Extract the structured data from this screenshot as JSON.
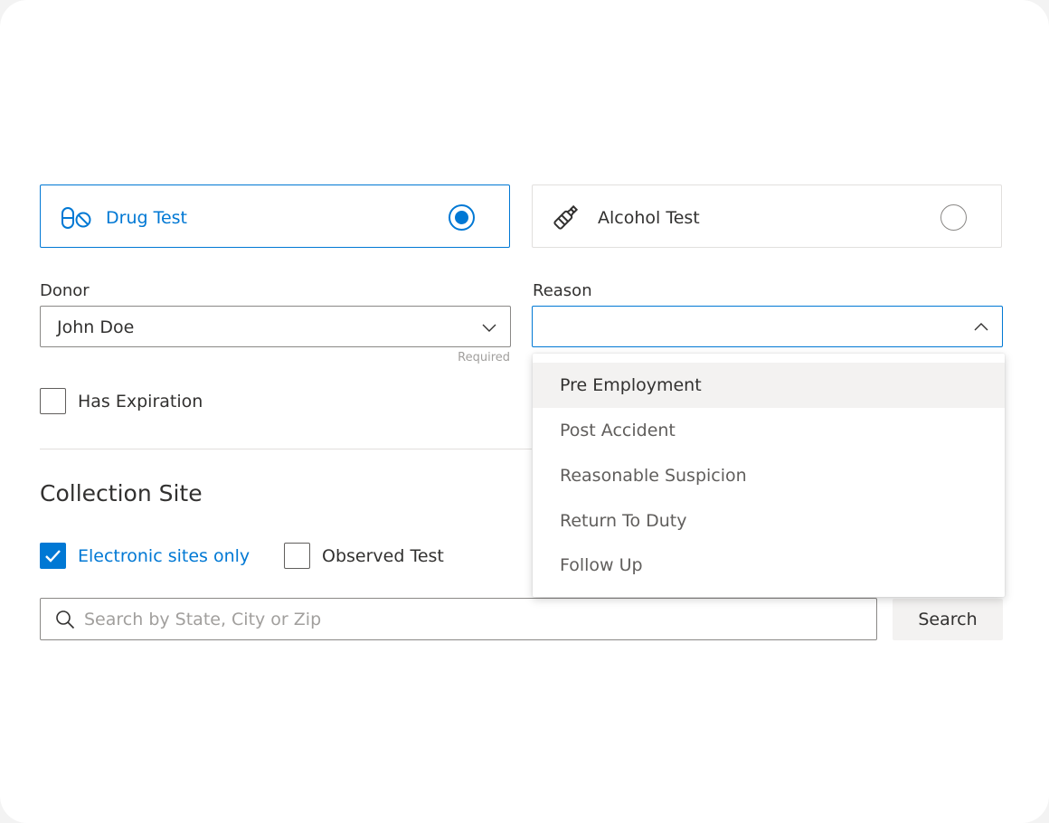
{
  "test_type": {
    "drug": {
      "label": "Drug Test",
      "selected": true,
      "icon": "pills-icon"
    },
    "alcohol": {
      "label": "Alcohol Test",
      "selected": false,
      "icon": "bottle-icon"
    }
  },
  "donor": {
    "label": "Donor",
    "value": "John Doe",
    "hint": "Required"
  },
  "reason": {
    "label": "Reason",
    "value": "",
    "options": [
      "Pre Employment",
      "Post Accident",
      "Reasonable Suspicion",
      "Return To Duty",
      "Follow Up"
    ],
    "highlighted_index": 0
  },
  "has_expiration": {
    "label": "Has Expiration",
    "checked": false
  },
  "collection_site": {
    "title": "Collection Site",
    "electronic_only": {
      "label": "Electronic sites only",
      "checked": true
    },
    "observed_test": {
      "label": "Observed Test",
      "checked": false
    },
    "search_placeholder": "Search by State, City or Zip",
    "search_button": "Search"
  },
  "colors": {
    "accent": "#0078d4",
    "text": "#323130",
    "border": "#8a8886"
  }
}
